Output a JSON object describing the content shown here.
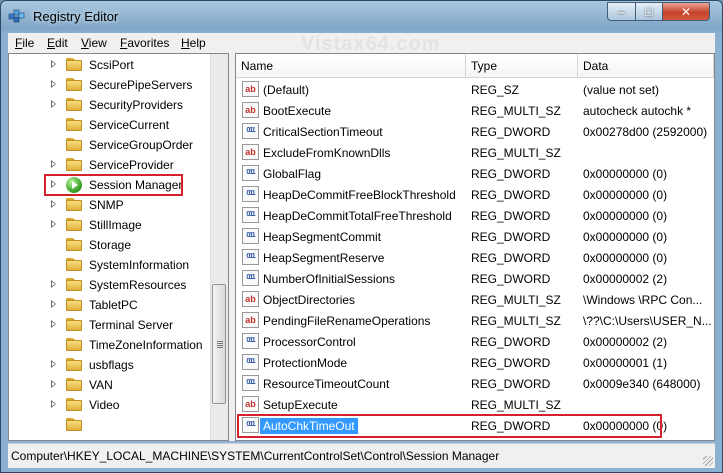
{
  "window": {
    "title": "Registry Editor",
    "controls": {
      "minimize": "–",
      "maximize": "□",
      "close": "✕"
    }
  },
  "menu": [
    "File",
    "Edit",
    "View",
    "Favorites",
    "Help"
  ],
  "watermark": "Vistax64.com",
  "tree": {
    "items": [
      {
        "label": "ScsiPort",
        "expandable": true
      },
      {
        "label": "SecurePipeServers",
        "expandable": true
      },
      {
        "label": "SecurityProviders",
        "expandable": true
      },
      {
        "label": "ServiceCurrent",
        "expandable": false
      },
      {
        "label": "ServiceGroupOrder",
        "expandable": false
      },
      {
        "label": "ServiceProvider",
        "expandable": true
      },
      {
        "label": "Session Manager",
        "expandable": true,
        "highlighted": true
      },
      {
        "label": "SNMP",
        "expandable": true
      },
      {
        "label": "StillImage",
        "expandable": true
      },
      {
        "label": "Storage",
        "expandable": false
      },
      {
        "label": "SystemInformation",
        "expandable": false
      },
      {
        "label": "SystemResources",
        "expandable": true
      },
      {
        "label": "TabletPC",
        "expandable": true
      },
      {
        "label": "Terminal Server",
        "expandable": true
      },
      {
        "label": "TimeZoneInformation",
        "expandable": false
      },
      {
        "label": "usbflags",
        "expandable": true
      },
      {
        "label": "VAN",
        "expandable": true
      },
      {
        "label": "Video",
        "expandable": true
      },
      {
        "label": "",
        "expandable": false
      }
    ]
  },
  "columns": {
    "name": "Name",
    "type": "Type",
    "data": "Data"
  },
  "values": [
    {
      "icon": "string-value-icon",
      "name": "(Default)",
      "type": "REG_SZ",
      "data": "(value not set)"
    },
    {
      "icon": "string-value-icon",
      "name": "BootExecute",
      "type": "REG_MULTI_SZ",
      "data": "autocheck autochk *"
    },
    {
      "icon": "binary-value-icon",
      "name": "CriticalSectionTimeout",
      "type": "REG_DWORD",
      "data": "0x00278d00 (2592000)"
    },
    {
      "icon": "string-value-icon",
      "name": "ExcludeFromKnownDlls",
      "type": "REG_MULTI_SZ",
      "data": ""
    },
    {
      "icon": "binary-value-icon",
      "name": "GlobalFlag",
      "type": "REG_DWORD",
      "data": "0x00000000 (0)"
    },
    {
      "icon": "binary-value-icon",
      "name": "HeapDeCommitFreeBlockThreshold",
      "type": "REG_DWORD",
      "data": "0x00000000 (0)"
    },
    {
      "icon": "binary-value-icon",
      "name": "HeapDeCommitTotalFreeThreshold",
      "type": "REG_DWORD",
      "data": "0x00000000 (0)"
    },
    {
      "icon": "binary-value-icon",
      "name": "HeapSegmentCommit",
      "type": "REG_DWORD",
      "data": "0x00000000 (0)"
    },
    {
      "icon": "binary-value-icon",
      "name": "HeapSegmentReserve",
      "type": "REG_DWORD",
      "data": "0x00000000 (0)"
    },
    {
      "icon": "binary-value-icon",
      "name": "NumberOfInitialSessions",
      "type": "REG_DWORD",
      "data": "0x00000002 (2)"
    },
    {
      "icon": "string-value-icon",
      "name": "ObjectDirectories",
      "type": "REG_MULTI_SZ",
      "data": "\\Windows \\RPC Con..."
    },
    {
      "icon": "string-value-icon",
      "name": "PendingFileRenameOperations",
      "type": "REG_MULTI_SZ",
      "data": "\\??\\C:\\Users\\USER_N..."
    },
    {
      "icon": "binary-value-icon",
      "name": "ProcessorControl",
      "type": "REG_DWORD",
      "data": "0x00000002 (2)"
    },
    {
      "icon": "binary-value-icon",
      "name": "ProtectionMode",
      "type": "REG_DWORD",
      "data": "0x00000001 (1)"
    },
    {
      "icon": "binary-value-icon",
      "name": "ResourceTimeoutCount",
      "type": "REG_DWORD",
      "data": "0x0009e340 (648000)"
    },
    {
      "icon": "string-value-icon",
      "name": "SetupExecute",
      "type": "REG_MULTI_SZ",
      "data": ""
    },
    {
      "icon": "binary-value-icon",
      "name": "AutoChkTimeOut",
      "type": "REG_DWORD",
      "data": "0x00000000 (0)",
      "selected": true
    }
  ],
  "status": {
    "path": "Computer\\HKEY_LOCAL_MACHINE\\SYSTEM\\CurrentControlSet\\Control\\Session Manager"
  },
  "colors": {
    "highlight_box": "#d4222c",
    "selection": "#3399ff"
  }
}
